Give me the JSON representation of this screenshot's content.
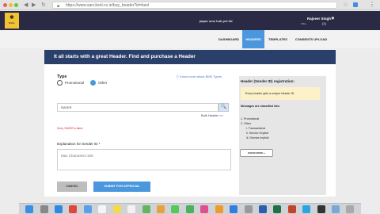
{
  "browser": {
    "url": "https://www.sarv.bsnl.co.in/buy_header?id=bsnl",
    "nav_back": "◀",
    "nav_forward": "▶",
    "nav_reload": "↻",
    "star": "☆",
    "menu": "⋮"
  },
  "topbar": {
    "logo_mark": "✱",
    "logo_text": "BSNL",
    "promo": "jaipur sms hub pvt ltd",
    "user_name": "Rajveer Singh",
    "user_sub": "TRA...",
    "user_badge": "(1)"
  },
  "nav": {
    "tabs": [
      "DASHBOARD",
      "HEADERS",
      "TEMPLATES",
      "CONSENTS UPLOAD"
    ]
  },
  "form": {
    "header_title": "It all starts with a great Header. Find and purchase a Header",
    "type_label": "Type",
    "option_promotional": "Promotional",
    "option_other": "Other",
    "know_more": "Ⓘ Know more about BMS Types",
    "header_value": "RAVER",
    "search_icon": "🔍",
    "bulk_header": "Bulk Header >>",
    "error_text": "Sorry, RAVER is taken",
    "explanation_label": "Explanation for Sender ID *",
    "explanation_placeholder": "Max Characters:100",
    "cancel": "CANCEL",
    "submit": "SUBMIT FOR APPROVAL"
  },
  "side": {
    "title": "Header (Sender ID) registration:",
    "note": "Every header gets a unique Header ID",
    "msg_title": "Messages are classified into:",
    "items": [
      "1. Promotional",
      "2. Other",
      "i. Transactional",
      "ii. Service Explicit",
      "iii. Service Implicit"
    ],
    "know_more_btn": "KNOW MORE »"
  },
  "colors": {
    "topbar": "#2a2a44",
    "accent": "#4a97dd",
    "panel_head": "#2a3f69",
    "error": "#d7282f",
    "note_bg": "#fcf1c8"
  },
  "dock_icons": [
    "finder-icon",
    "launchpad-icon",
    "safari-icon",
    "chrome-icon",
    "mail-icon",
    "calendar-icon",
    "notes-icon",
    "reminders-icon",
    "maps-icon",
    "photos-icon",
    "messages-icon",
    "facetime-icon",
    "itunes-icon",
    "books-icon",
    "appstore-icon",
    "settings-icon",
    "word-icon",
    "excel-icon",
    "powerpoint-icon",
    "skype-icon",
    "terminal-icon",
    "preview-icon",
    "trash-icon"
  ],
  "dock_colors": [
    "#3b8ee8",
    "#888888",
    "#2d8ae0",
    "#e1463b",
    "#5aa0e8",
    "#f5f5f5",
    "#f7d94a",
    "#f2f2f2",
    "#64b55e",
    "#e8a23c",
    "#52c95a",
    "#4cb05d",
    "#e24f8a",
    "#f09a2b",
    "#2f7fe0",
    "#9a9a9a",
    "#2b5fad",
    "#207245",
    "#c4442a",
    "#2aa5e0",
    "#333333",
    "#7aa7d8",
    "#a9a9a9"
  ]
}
